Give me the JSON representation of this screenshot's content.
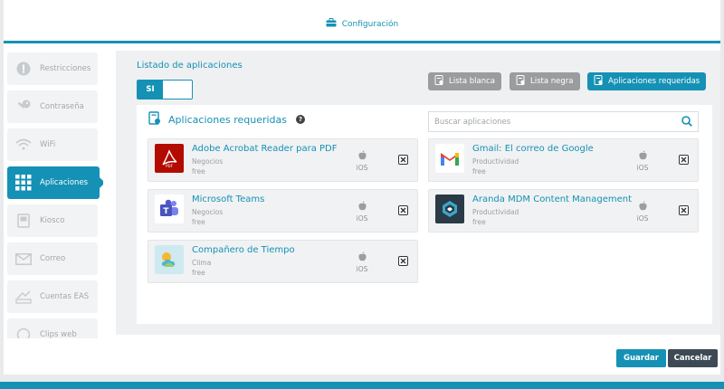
{
  "header": {
    "title": "Configuración",
    "icon": "briefcase-icon"
  },
  "sidebar": {
    "items": [
      {
        "label": "Restricciones",
        "icon": "exclamation-icon"
      },
      {
        "label": "Contraseña",
        "icon": "key-icon"
      },
      {
        "label": "WiFi",
        "icon": "wifi-icon"
      },
      {
        "label": "Aplicaciones",
        "icon": "grid-icon",
        "active": true
      },
      {
        "label": "Kiosco",
        "icon": "kiosk-icon"
      },
      {
        "label": "Correo",
        "icon": "mail-icon"
      },
      {
        "label": "Cuentas EAS",
        "icon": "sync-icon"
      },
      {
        "label": "Clips web",
        "icon": "web-clips-icon"
      }
    ]
  },
  "main": {
    "list_label": "Listado de aplicaciones",
    "toggle_value": "SI",
    "tabs": [
      {
        "label": "Lista blanca",
        "style": "gray"
      },
      {
        "label": "Lista negra",
        "style": "gray"
      },
      {
        "label": "Aplicaciones requeridas",
        "style": "blue",
        "active": true
      }
    ],
    "section_title": "Aplicaciones requeridas",
    "search_placeholder": "Buscar aplicaciones",
    "apps": [
      {
        "name": "Adobe Acrobat Reader para PDF",
        "category": "Negocios",
        "price": "free",
        "os": "iOS",
        "logo_color": "#b30b00"
      },
      {
        "name": "Gmail: El correo de Google",
        "category": "Productividad",
        "price": "free",
        "os": "iOS",
        "logo_color": "#ffffff"
      },
      {
        "name": "Microsoft Teams",
        "category": "Negocios",
        "price": "free",
        "os": "iOS",
        "logo_color": "#ffffff"
      },
      {
        "name": "Aranda MDM Content Management",
        "category": "Productividad",
        "price": "free",
        "os": "iOS",
        "logo_color": "#2a3b47"
      },
      {
        "name": "Compañero de Tiempo",
        "category": "Clima",
        "price": "free",
        "os": "iOS",
        "logo_color": "#cfe9f0"
      }
    ]
  },
  "footer": {
    "save_label": "Guardar",
    "cancel_label": "Cancelar"
  },
  "colors": {
    "accent": "#1591b5",
    "dark": "#3d4a55",
    "gray_button": "#9a9c9e"
  }
}
